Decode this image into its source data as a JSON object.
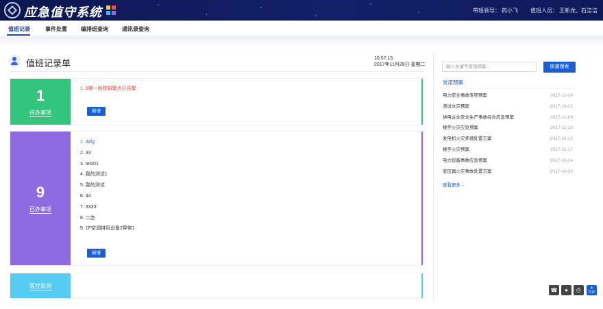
{
  "header": {
    "title": "应急值守系统",
    "leader_label": "带班领导：",
    "leader_name": "药小飞",
    "staff_label": "值班人员：",
    "staff_names": "王新龙、石洁洁",
    "colors": {
      "top_bar": "#0e1b5e",
      "accent": "#1a5ed1"
    }
  },
  "nav": {
    "tabs": [
      "值班记录",
      "事件处置",
      "编排班查询",
      "通讯录查询"
    ],
    "active_index": 0
  },
  "page": {
    "title": "值班记录单",
    "time": "10:57:15",
    "date": "2017年11月28日 星期二"
  },
  "pending": {
    "count": "1",
    "label": "待办事项",
    "color": "#33c57c",
    "items": [
      "1. 9楼一医院报警点已告警"
    ],
    "item_color": "#e04646",
    "add_label": "新增"
  },
  "done": {
    "count": "9",
    "label": "已办事项",
    "color": "#8e6be0",
    "items": [
      "1. dzfg",
      "2. 33",
      "3. test01",
      "4. 我的测试1",
      "5. 我的测试",
      "6. 44",
      "7. 3333",
      "8. 二恋",
      "9. 1F空调排风设备2异常1"
    ],
    "add_label": "新增"
  },
  "medical": {
    "label": "医疗监测",
    "color": "#56ccf2"
  },
  "sidebar": {
    "search_placeholder": "输入关键字查询预案...",
    "search_button": "快速搜索",
    "quick_title": "常用预案",
    "plans": [
      {
        "name": "电力安全事故专项预案",
        "date": "2017-11-14"
      },
      {
        "name": "测试水灾预案",
        "date": "2017-10-12"
      },
      {
        "name": "供电企业安全生产事故综合应急预案",
        "date": "2017-11-09"
      },
      {
        "name": "楼宇火灾应急预案",
        "date": "2017-11-23"
      },
      {
        "name": "发电机火灾师傅处置方案",
        "date": "2017-10-12"
      },
      {
        "name": "楼宇火灾预案",
        "date": "2017-11-17"
      },
      {
        "name": "电力设备事故应急预案",
        "date": "2017-10-24"
      },
      {
        "name": "变压器火灾事故处置方案",
        "date": "2017-10-20"
      }
    ],
    "more_link": "查看更多..."
  },
  "floating": {
    "icons": [
      "phone-icon",
      "chat-icon",
      "print-icon",
      "back-to-top-icon"
    ],
    "top_label": "TOP"
  }
}
